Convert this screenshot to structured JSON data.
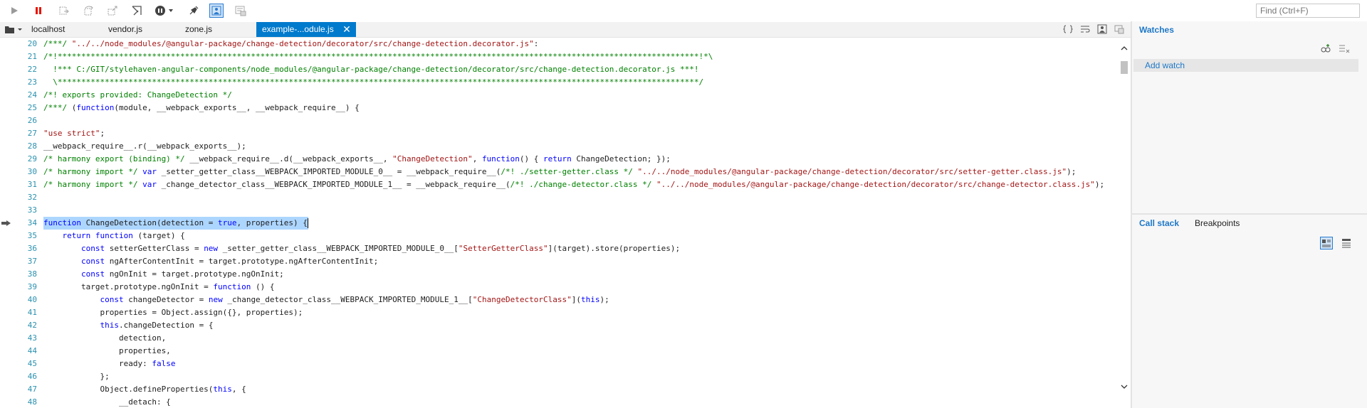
{
  "toolbar": {
    "buttons": [
      {
        "name": "continue",
        "icon": "play-icon"
      },
      {
        "name": "break-all",
        "icon": "pause-icon"
      },
      {
        "name": "step-into",
        "icon": "step-into-icon"
      },
      {
        "name": "step-over",
        "icon": "step-over-icon"
      },
      {
        "name": "step-out",
        "icon": "step-out-icon"
      },
      {
        "name": "break-new-worker",
        "icon": "worker-icon"
      },
      {
        "name": "exceptions",
        "icon": "exception-icon"
      },
      {
        "name": "disable-breakpoints",
        "icon": "breakpoints-off-icon"
      },
      {
        "name": "just-my-code",
        "icon": "just-my-code-icon",
        "active": true
      },
      {
        "name": "pretty-print",
        "icon": "pretty-print-icon"
      }
    ],
    "find_placeholder": "Find (Ctrl+F)"
  },
  "tabs": [
    {
      "label": "localhost",
      "active": false
    },
    {
      "label": "vendor.js",
      "active": false
    },
    {
      "label": "zone.js",
      "active": false
    },
    {
      "label": "example-...odule.js",
      "active": true
    }
  ],
  "colors": {
    "accent": "#007acc",
    "line_number": "#2b91af",
    "comment": "#008000",
    "keyword": "#0000ff",
    "string": "#a31515",
    "selection": "#add6ff",
    "panel_title": "#1e78c8"
  },
  "code": {
    "current_line": "34",
    "lines": [
      {
        "n": "20",
        "segs": [
          {
            "t": "/***/ ",
            "c": "comment"
          },
          {
            "t": "\"../../node_modules/@angular-package/change-detection/decorator/src/change-detection.decorator.js\"",
            "c": "string"
          },
          {
            "t": ":",
            "c": ""
          }
        ]
      },
      {
        "n": "21",
        "segs": [
          {
            "t": "/*!****************************************************************************************************************************************!*\\",
            "c": "comment"
          }
        ]
      },
      {
        "n": "22",
        "segs": [
          {
            "t": "  !*** C:/GIT/stylehaven-angular-components/node_modules/@angular-package/change-detection/decorator/src/change-detection.decorator.js ***!",
            "c": "comment"
          }
        ]
      },
      {
        "n": "23",
        "segs": [
          {
            "t": "  \\****************************************************************************************************************************************/",
            "c": "comment"
          }
        ]
      },
      {
        "n": "24",
        "segs": [
          {
            "t": "/*! exports provided: ChangeDetection */",
            "c": "comment"
          }
        ]
      },
      {
        "n": "25",
        "segs": [
          {
            "t": "/***/ ",
            "c": "comment"
          },
          {
            "t": "(",
            "c": ""
          },
          {
            "t": "function",
            "c": "keyword"
          },
          {
            "t": "(module, __webpack_exports__, __webpack_require__) {",
            "c": ""
          }
        ]
      },
      {
        "n": "26",
        "segs": []
      },
      {
        "n": "27",
        "segs": [
          {
            "t": "\"use strict\"",
            "c": "string"
          },
          {
            "t": ";",
            "c": ""
          }
        ]
      },
      {
        "n": "28",
        "segs": [
          {
            "t": "__webpack_require__.r(__webpack_exports__);",
            "c": ""
          }
        ]
      },
      {
        "n": "29",
        "segs": [
          {
            "t": "/* harmony export (binding) */ ",
            "c": "comment"
          },
          {
            "t": "__webpack_require__.d(__webpack_exports__, ",
            "c": ""
          },
          {
            "t": "\"ChangeDetection\"",
            "c": "string"
          },
          {
            "t": ", ",
            "c": ""
          },
          {
            "t": "function",
            "c": "keyword"
          },
          {
            "t": "() { ",
            "c": ""
          },
          {
            "t": "return",
            "c": "keyword"
          },
          {
            "t": " ChangeDetection; });",
            "c": ""
          }
        ]
      },
      {
        "n": "30",
        "segs": [
          {
            "t": "/* harmony import */ ",
            "c": "comment"
          },
          {
            "t": "var",
            "c": "keyword"
          },
          {
            "t": " _setter_getter_class__WEBPACK_IMPORTED_MODULE_0__ = __webpack_require__(",
            "c": ""
          },
          {
            "t": "/*! ./setter-getter.class */ ",
            "c": "comment"
          },
          {
            "t": "\"../../node_modules/@angular-package/change-detection/decorator/src/setter-getter.class.js\"",
            "c": "string"
          },
          {
            "t": ");",
            "c": ""
          }
        ]
      },
      {
        "n": "31",
        "segs": [
          {
            "t": "/* harmony import */ ",
            "c": "comment"
          },
          {
            "t": "var",
            "c": "keyword"
          },
          {
            "t": " _change_detector_class__WEBPACK_IMPORTED_MODULE_1__ = __webpack_require__(",
            "c": ""
          },
          {
            "t": "/*! ./change-detector.class */ ",
            "c": "comment"
          },
          {
            "t": "\"../../node_modules/@angular-package/change-detection/decorator/src/change-detector.class.js\"",
            "c": "string"
          },
          {
            "t": ");",
            "c": ""
          }
        ]
      },
      {
        "n": "32",
        "segs": []
      },
      {
        "n": "33",
        "segs": []
      },
      {
        "n": "34",
        "sel": true,
        "segs": [
          {
            "t": "function",
            "c": "keyword"
          },
          {
            "t": " ChangeDetection(detection = ",
            "c": ""
          },
          {
            "t": "true",
            "c": "keyword"
          },
          {
            "t": ", properties) {",
            "c": ""
          }
        ]
      },
      {
        "n": "35",
        "segs": [
          {
            "t": "    ",
            "c": ""
          },
          {
            "t": "return",
            "c": "keyword"
          },
          {
            "t": " ",
            "c": ""
          },
          {
            "t": "function",
            "c": "keyword"
          },
          {
            "t": " (target) {",
            "c": ""
          }
        ]
      },
      {
        "n": "36",
        "segs": [
          {
            "t": "        ",
            "c": ""
          },
          {
            "t": "const",
            "c": "keyword"
          },
          {
            "t": " setterGetterClass = ",
            "c": ""
          },
          {
            "t": "new",
            "c": "keyword"
          },
          {
            "t": " _setter_getter_class__WEBPACK_IMPORTED_MODULE_0__[",
            "c": ""
          },
          {
            "t": "\"SetterGetterClass\"",
            "c": "string"
          },
          {
            "t": "](target).store(properties);",
            "c": ""
          }
        ]
      },
      {
        "n": "37",
        "segs": [
          {
            "t": "        ",
            "c": ""
          },
          {
            "t": "const",
            "c": "keyword"
          },
          {
            "t": " ngAfterContentInit = target.prototype.ngAfterContentInit;",
            "c": ""
          }
        ]
      },
      {
        "n": "38",
        "segs": [
          {
            "t": "        ",
            "c": ""
          },
          {
            "t": "const",
            "c": "keyword"
          },
          {
            "t": " ngOnInit = target.prototype.ngOnInit;",
            "c": ""
          }
        ]
      },
      {
        "n": "39",
        "segs": [
          {
            "t": "        target.prototype.ngOnInit = ",
            "c": ""
          },
          {
            "t": "function",
            "c": "keyword"
          },
          {
            "t": " () {",
            "c": ""
          }
        ]
      },
      {
        "n": "40",
        "segs": [
          {
            "t": "            ",
            "c": ""
          },
          {
            "t": "const",
            "c": "keyword"
          },
          {
            "t": " changeDetector = ",
            "c": ""
          },
          {
            "t": "new",
            "c": "keyword"
          },
          {
            "t": " _change_detector_class__WEBPACK_IMPORTED_MODULE_1__[",
            "c": ""
          },
          {
            "t": "\"ChangeDetectorClass\"",
            "c": "string"
          },
          {
            "t": "](",
            "c": ""
          },
          {
            "t": "this",
            "c": "keyword"
          },
          {
            "t": ");",
            "c": ""
          }
        ]
      },
      {
        "n": "41",
        "segs": [
          {
            "t": "            properties = Object.assign({}, properties);",
            "c": ""
          }
        ]
      },
      {
        "n": "42",
        "segs": [
          {
            "t": "            ",
            "c": ""
          },
          {
            "t": "this",
            "c": "keyword"
          },
          {
            "t": ".changeDetection = {",
            "c": ""
          }
        ]
      },
      {
        "n": "43",
        "segs": [
          {
            "t": "                detection,",
            "c": ""
          }
        ]
      },
      {
        "n": "44",
        "segs": [
          {
            "t": "                properties,",
            "c": ""
          }
        ]
      },
      {
        "n": "45",
        "segs": [
          {
            "t": "                ready: ",
            "c": ""
          },
          {
            "t": "false",
            "c": "keyword"
          }
        ]
      },
      {
        "n": "46",
        "segs": [
          {
            "t": "            };",
            "c": ""
          }
        ]
      },
      {
        "n": "47",
        "segs": [
          {
            "t": "            Object.defineProperties(",
            "c": ""
          },
          {
            "t": "this",
            "c": "keyword"
          },
          {
            "t": ", {",
            "c": ""
          }
        ]
      },
      {
        "n": "48",
        "segs": [
          {
            "t": "                __detach: {",
            "c": ""
          }
        ]
      }
    ]
  },
  "watches": {
    "title": "Watches",
    "add_watch": "Add watch"
  },
  "bottom_panel": {
    "tabs": [
      {
        "label": "Call stack",
        "active": true
      },
      {
        "label": "Breakpoints",
        "active": false
      }
    ]
  }
}
